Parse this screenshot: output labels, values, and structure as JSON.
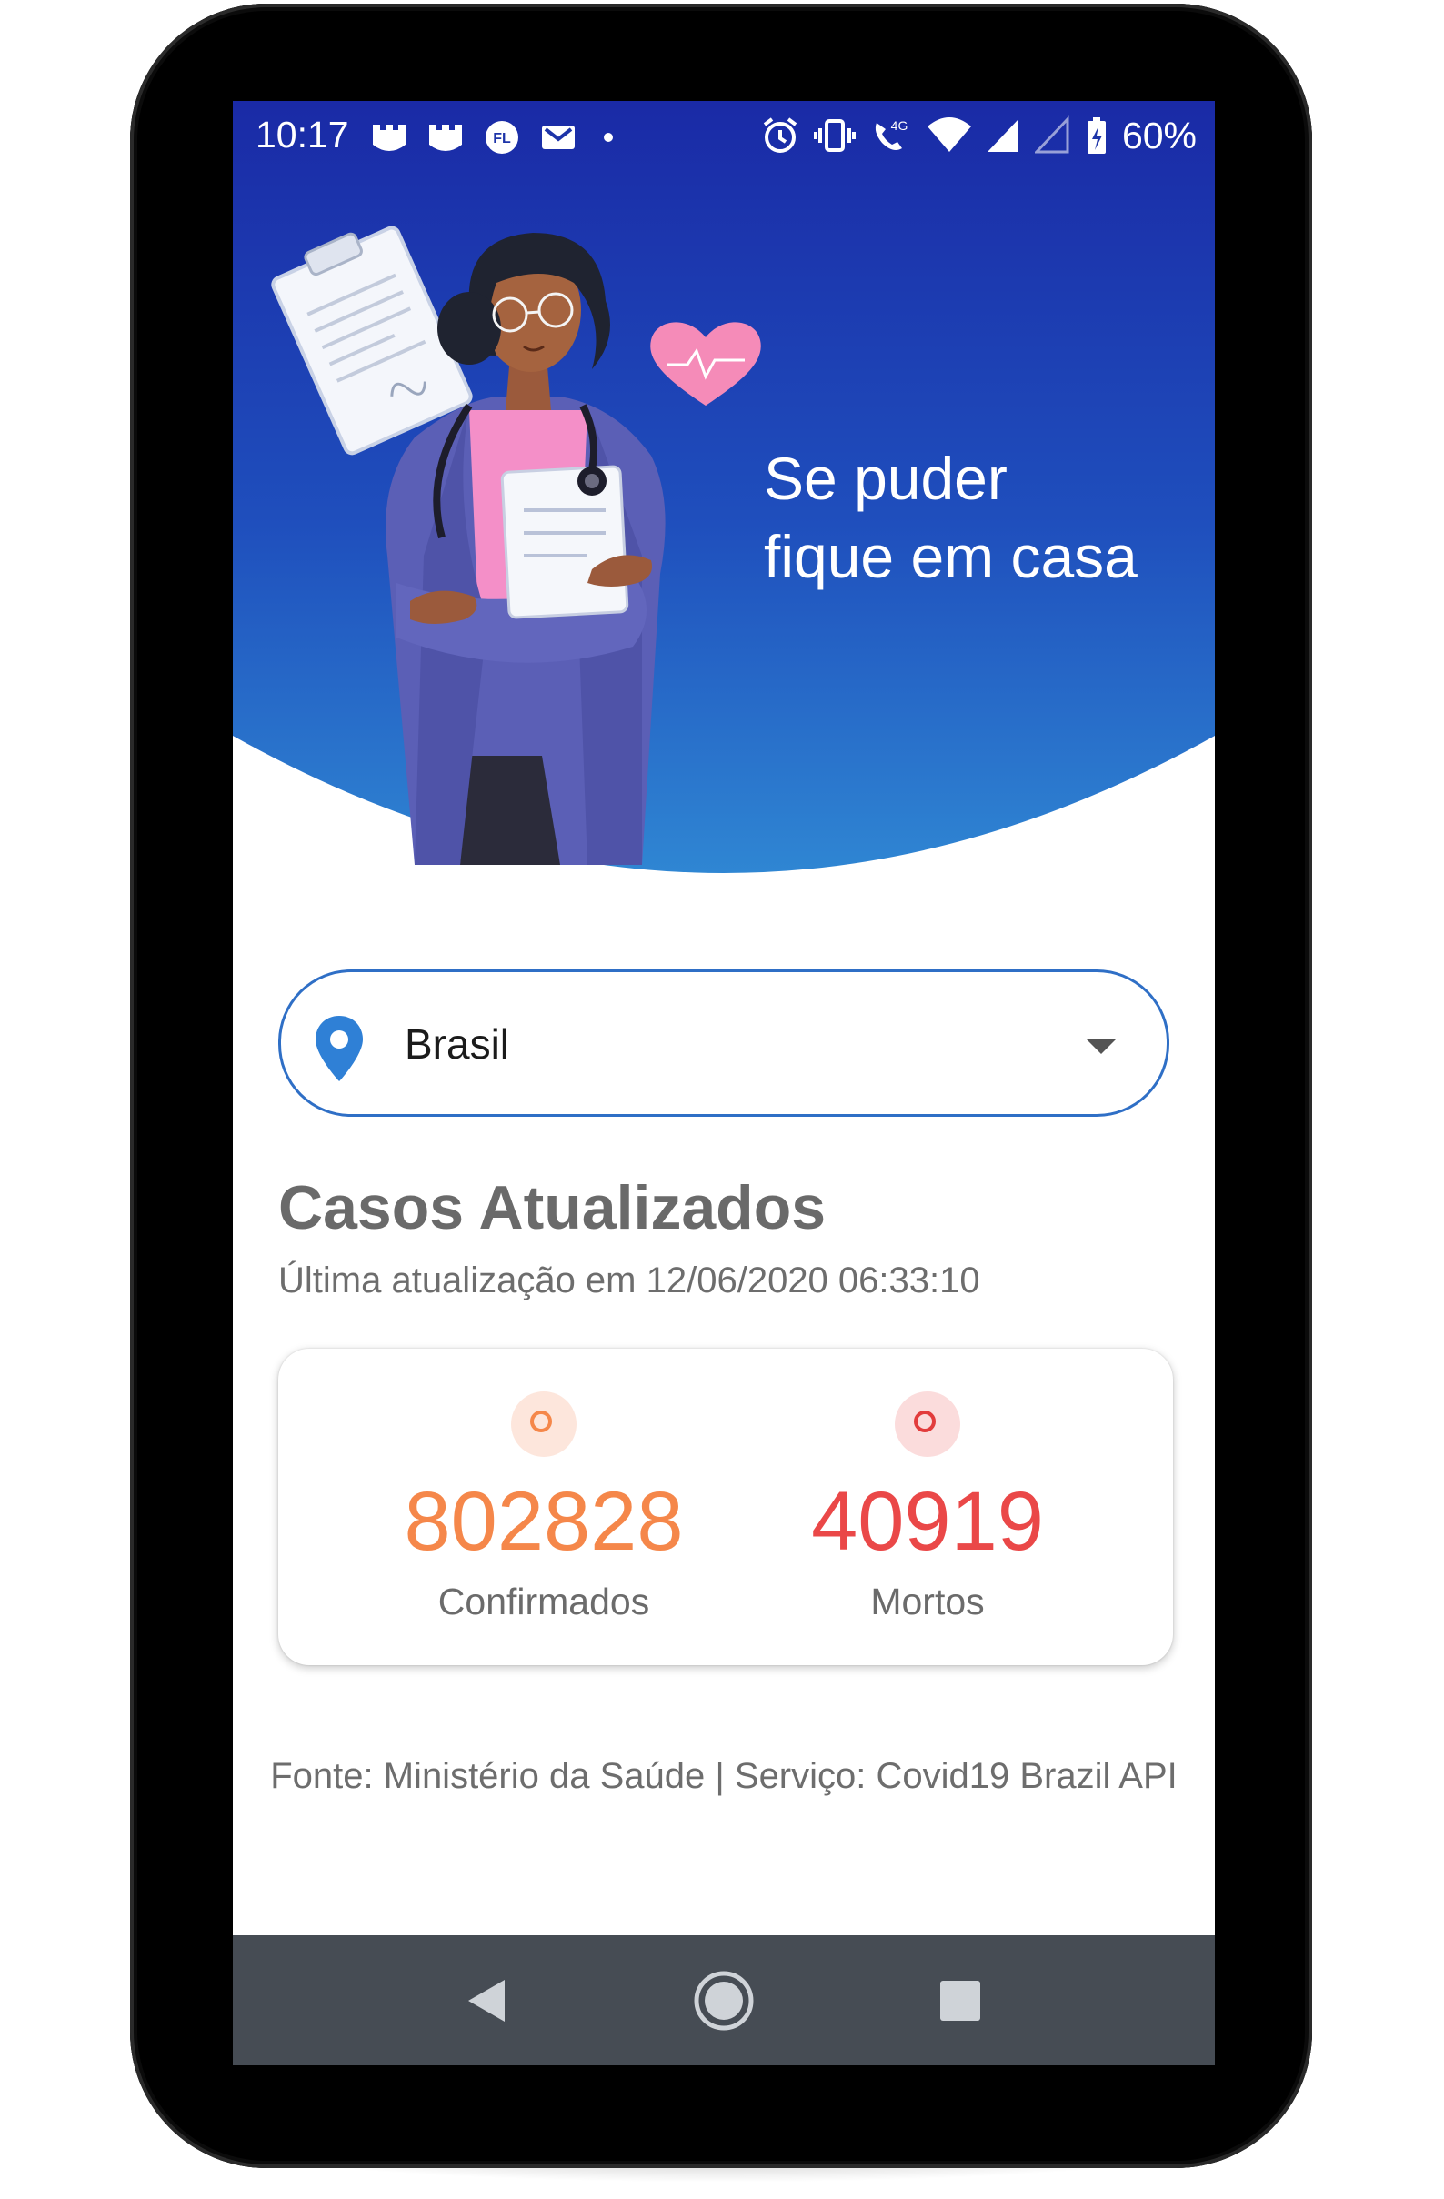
{
  "status_bar": {
    "time": "10:17",
    "battery_percent": "60%",
    "left_icons": [
      "castle-icon",
      "castle-icon",
      "fl-app-icon",
      "gmail-icon",
      "dot-icon"
    ],
    "right_icons": [
      "alarm-icon",
      "vibrate-icon",
      "volte-4g-icon",
      "wifi-icon",
      "signal-icon",
      "signal-empty-icon",
      "battery-charging-icon"
    ]
  },
  "hero": {
    "tagline_line1": "Se puder",
    "tagline_line2": "fique em casa",
    "gradient_top": "#1b2ea8",
    "gradient_bottom": "#2f7fd1"
  },
  "location_select": {
    "selected": "Brasil",
    "pin_color": "#2f80d6"
  },
  "cases": {
    "title": "Casos Atualizados",
    "last_update": "Última atualização em 12/06/2020 06:33:10",
    "confirmed_value": "802828",
    "confirmed_label": "Confirmados",
    "confirmed_color": "#f5874a",
    "deaths_value": "40919",
    "deaths_label": "Mortos",
    "deaths_color": "#ea4848"
  },
  "footer": {
    "source": "Fonte: Ministério da Saúde | Serviço: Covid19 Brazil API"
  },
  "nav_bar": {
    "back_icon": "back-icon",
    "home_icon": "home-icon",
    "recents_icon": "recents-icon"
  }
}
